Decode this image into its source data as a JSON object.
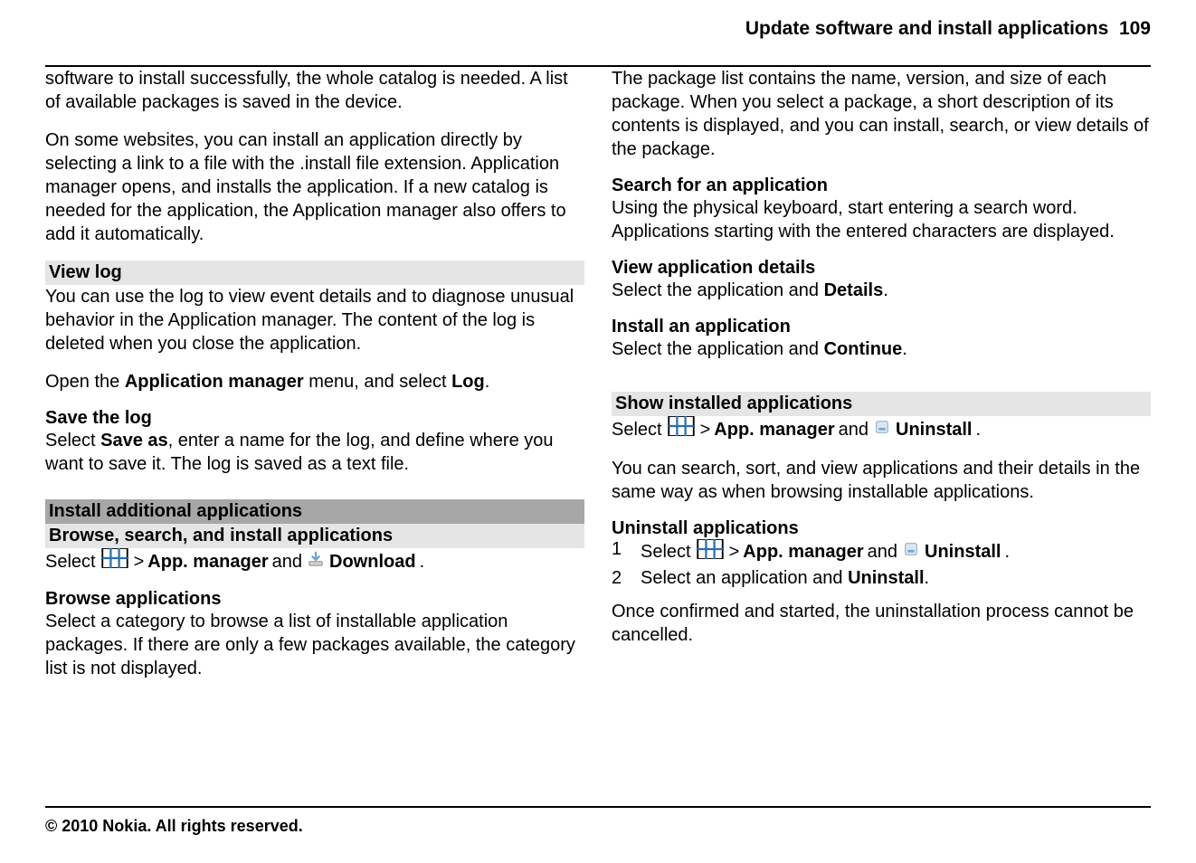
{
  "header": {
    "title": "Update software and install applications",
    "page": "109"
  },
  "left": {
    "p1": "software to install successfully, the whole catalog is needed. A list of available packages is saved in the device.",
    "p2": "On some websites, you can install an application directly by selecting a link to a file with the .install file extension. Application manager opens, and installs the application. If a new catalog is needed for the application, the Application manager also offers to add it automatically.",
    "viewlog": {
      "h": "View log",
      "p": "You can use the log to view event details and to diagnose unusual behavior in the Application manager. The content of the log is deleted when you close the application.",
      "open_pre": "Open the ",
      "open_b": "Application manager",
      "open_mid": " menu, and select ",
      "open_b2": "Log",
      "open_end": "."
    },
    "savelog": {
      "h": "Save the log",
      "pre": "Select ",
      "b": "Save as",
      "rest": ", enter a name for the log, and define where you want to save it. The log is saved as a text file."
    },
    "install": {
      "h1": "Install additional applications",
      "h2": "Browse, search, and install applications",
      "sel": "Select",
      "gt": ">",
      "app": "App. manager",
      "and": "and",
      "dl": "Download",
      "dot": "."
    },
    "browse": {
      "h": "Browse applications",
      "p": "Select a category to browse a list of installable application packages. If there are only a few packages available, the category list is not displayed."
    }
  },
  "right": {
    "p1": "The package list contains the name, version, and size of each package. When you select a package, a short description of its contents is displayed, and you can install, search, or view details of the package.",
    "search": {
      "h": "Search for an application",
      "p": "Using the physical keyboard, start entering a search word. Applications starting with the entered characters are displayed."
    },
    "details": {
      "h": "View application details",
      "pre": "Select the application and ",
      "b": "Details",
      "end": "."
    },
    "installapp": {
      "h": "Install an application",
      "pre": "Select the application and ",
      "b": "Continue",
      "end": "."
    },
    "show": {
      "h": "Show installed applications",
      "sel": "Select",
      "gt": ">",
      "app": "App. manager",
      "and": "and",
      "un": "Uninstall",
      "dot": ".",
      "p": "You can search, sort, and view applications and their details in the same way as when browsing installable applications."
    },
    "uninstall": {
      "h": "Uninstall applications",
      "n1": "1",
      "n2": "2",
      "s1_sel": "Select",
      "s1_gt": ">",
      "s1_app": "App. manager",
      "s1_and": "and",
      "s1_un": "Uninstall",
      "s1_dot": ".",
      "s2_pre": "Select an application and ",
      "s2_b": "Uninstall",
      "s2_end": ".",
      "p": "Once confirmed and started, the uninstallation process cannot be cancelled."
    }
  },
  "footer": "© 2010 Nokia. All rights reserved."
}
